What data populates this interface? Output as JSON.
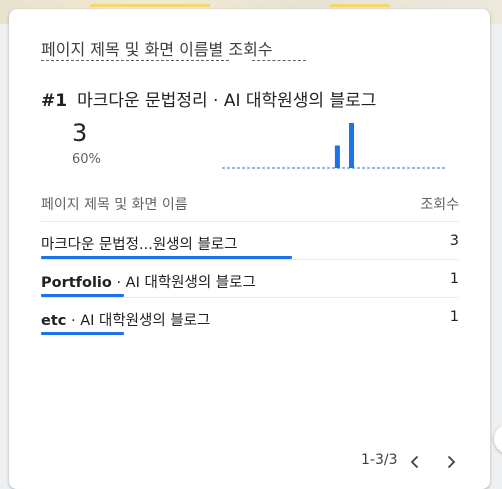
{
  "card": {
    "title": "페이지 제목 및 화면 이름별 조회수",
    "top": {
      "rank": "#1",
      "name": "마크다운 문법정리 · AI 대학원생의 블로그",
      "value": "3",
      "percent": "60%"
    },
    "sparkline": {
      "bars": [
        0,
        0,
        0,
        0,
        0,
        0,
        0,
        0,
        0,
        0,
        0,
        0,
        0,
        0,
        0,
        0,
        0,
        0,
        0,
        0,
        0,
        0,
        0,
        0,
        1,
        0,
        0,
        2,
        0,
        0,
        0,
        0,
        0,
        0,
        0,
        0,
        0,
        0,
        0,
        0,
        0,
        0,
        0,
        0,
        0,
        0,
        0,
        0
      ],
      "color": "#1a73e8"
    },
    "table": {
      "header_name": "페이지 제목 및 화면 이름",
      "header_views": "조회수",
      "rows": [
        {
          "name": "마크다운 문법정...원생의 블로그",
          "value": "3",
          "share": 1.0
        },
        {
          "name_bold": "Portfolio",
          "name_rest": " · AI 대학원생의 블로그",
          "value": "1",
          "share": 0.33
        },
        {
          "name_bold": "etc",
          "name_rest": " · AI 대학원생의 블로그",
          "value": "1",
          "share": 0.33
        }
      ]
    },
    "pagination": {
      "label": "1-3/3"
    }
  },
  "colors": {
    "accent": "#1a73e8",
    "text": "#202124",
    "muted": "#5f6368"
  },
  "icons": {
    "prev": "chevron-left-icon",
    "next": "chevron-right-icon"
  }
}
